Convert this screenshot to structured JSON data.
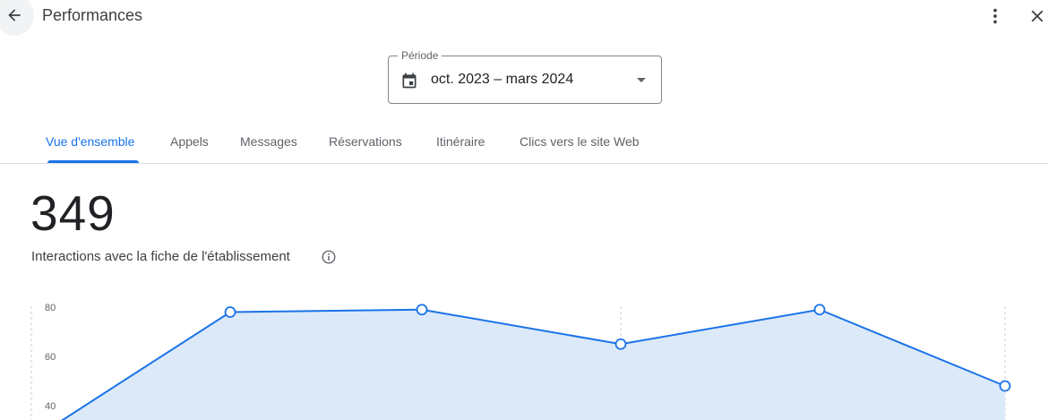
{
  "header": {
    "title": "Performances",
    "icons": {
      "back": "arrow-back-icon",
      "more": "more-vert-icon",
      "close": "close-icon"
    }
  },
  "period": {
    "label": "Période",
    "value": "oct. 2023 – mars 2024",
    "icons": {
      "calendar": "calendar-icon",
      "dropdown": "arrow-drop-down-icon"
    }
  },
  "tabs": [
    {
      "label": "Vue d'ensemble",
      "active": true
    },
    {
      "label": "Appels",
      "active": false
    },
    {
      "label": "Messages",
      "active": false
    },
    {
      "label": "Réservations",
      "active": false
    },
    {
      "label": "Itinéraire",
      "active": false
    },
    {
      "label": "Clics vers le site Web",
      "active": false
    }
  ],
  "metric": {
    "total": "349",
    "label": "Interactions avec la fiche de l'établissement",
    "info_icon": "info-icon"
  },
  "colors": {
    "accent": "#1a73e8",
    "line": "#1a73e8",
    "area_fill": "#dce9f9",
    "grid": "#c8cdd3"
  },
  "chart_data": {
    "type": "area",
    "title": "",
    "xlabel": "",
    "ylabel": "",
    "yticks": [
      "80",
      "60",
      "40"
    ],
    "ylim": [
      20,
      80
    ],
    "series": [
      {
        "values": [
          26,
          78,
          79,
          65,
          79,
          48
        ]
      }
    ],
    "markers": [
      false,
      true,
      true,
      true,
      true,
      true
    ],
    "grid": true
  }
}
